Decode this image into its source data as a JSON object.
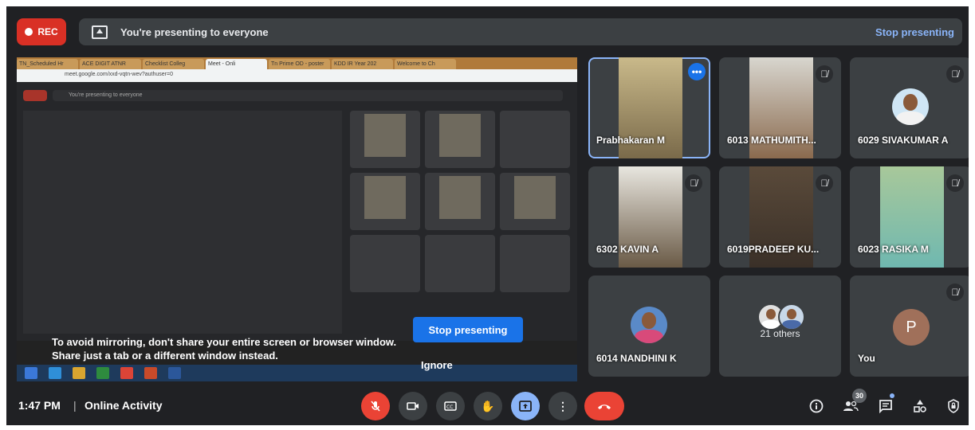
{
  "topbar": {
    "rec_label": "REC",
    "presenting_text": "You're presenting to everyone",
    "stop_presenting": "Stop presenting"
  },
  "shared_screen": {
    "tabs": [
      "TN_Scheduled Hr",
      "ACE DIGIT ATNR",
      "Checklist Colleg",
      "Meet - Onli",
      "Tn Prime OD - poster",
      "KDD IR Year 202",
      "Welcome to Ch"
    ],
    "url": "meet.google.com/xxd-vqtn-wev?authuser=0",
    "mirroring_text_line1": "To avoid mirroring, don't share your entire screen or browser window.",
    "mirroring_text_line2": "Share just a tab or a different window instead.",
    "stop_presenting_btn": "Stop presenting",
    "ignore": "Ignore"
  },
  "participants": [
    {
      "name": "Prabhakaran M",
      "active": true
    },
    {
      "name": "6013 MATHUMITH..."
    },
    {
      "name": "6029 SIVAKUMAR A"
    },
    {
      "name": "6302 KAVIN A"
    },
    {
      "name": "6019PRADEEP KU..."
    },
    {
      "name": "6023 RASIKA M"
    },
    {
      "name": "6014 NANDHINI K"
    },
    {
      "name": "21 others"
    },
    {
      "name": "You",
      "initial": "P"
    }
  ],
  "bottom": {
    "time": "1:47 PM",
    "separator": "|",
    "meeting_name": "Online Activity",
    "participant_count": "30"
  },
  "colors": {
    "background": "#202124",
    "tile": "#3c4043",
    "accent_blue": "#1a73e8",
    "red": "#ea4335",
    "link_blue": "#8ab4f8"
  }
}
